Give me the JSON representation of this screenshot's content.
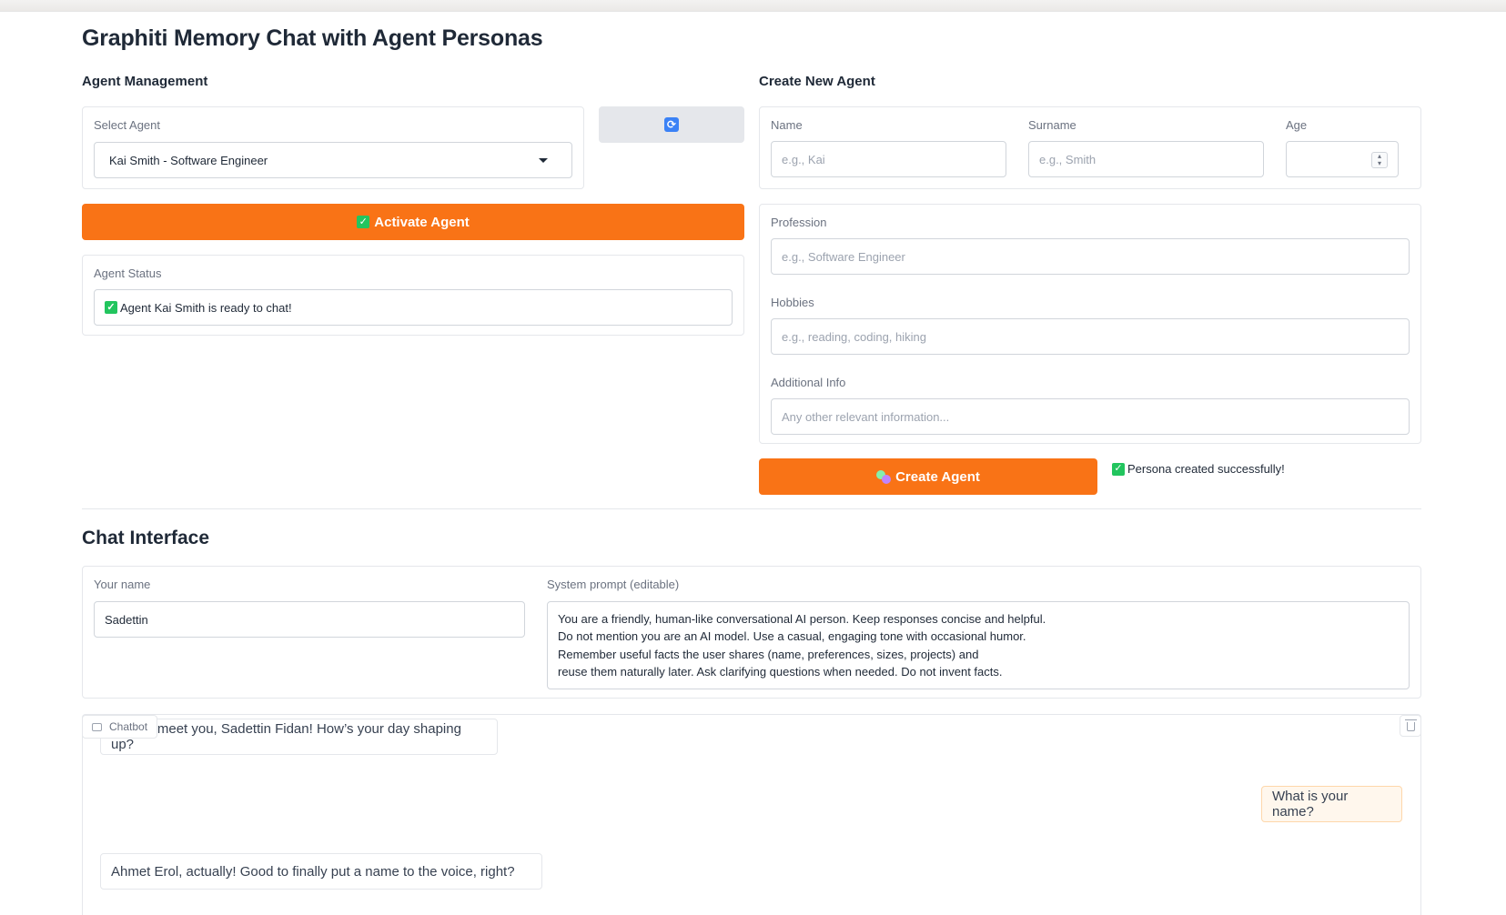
{
  "page": {
    "title": "Graphiti Memory Chat with Agent Personas"
  },
  "agent_management": {
    "heading": "Agent Management",
    "select_label": "Select Agent",
    "selected_agent": "Kai Smith - Software Engineer",
    "refresh_icon": "refresh-icon",
    "activate_label": "Activate Agent",
    "status_label": "Agent Status",
    "status_text": "Agent Kai Smith is ready to chat!"
  },
  "create_agent": {
    "heading": "Create New Agent",
    "name_label": "Name",
    "name_placeholder": "e.g., Kai",
    "surname_label": "Surname",
    "surname_placeholder": "e.g., Smith",
    "age_label": "Age",
    "profession_label": "Profession",
    "profession_placeholder": "e.g., Software Engineer",
    "hobbies_label": "Hobbies",
    "hobbies_placeholder": "e.g., reading, coding, hiking",
    "additional_label": "Additional Info",
    "additional_placeholder": "Any other relevant information...",
    "create_label": "Create Agent",
    "create_result": "Persona created successfully!"
  },
  "chat": {
    "heading": "Chat Interface",
    "your_name_label": "Your name",
    "your_name_value": "Sadettin",
    "system_prompt_label": "System prompt (editable)",
    "system_prompt_lines": [
      "You are a friendly, human-like conversational AI person. Keep responses concise and helpful.",
      "Do not mention you are an AI model. Use a casual, engaging tone with occasional humor.",
      "Remember useful facts the user shares (name, preferences, sizes, projects) and",
      "reuse them naturally later. Ask clarifying questions when needed. Do not invent facts."
    ],
    "chatbot_tag": "Chatbot",
    "messages": [
      {
        "role": "bot",
        "text": "Nice to meet you, Sadettin Fidan! How’s your day shaping up?"
      },
      {
        "role": "user",
        "text": "What is your name?"
      },
      {
        "role": "bot",
        "text": "Ahmet Erol, actually! Good to finally put a name to the voice, right?"
      }
    ]
  },
  "colors": {
    "accent": "#f97316",
    "success": "#22c55e",
    "user_bubble": "#fff7ed"
  }
}
